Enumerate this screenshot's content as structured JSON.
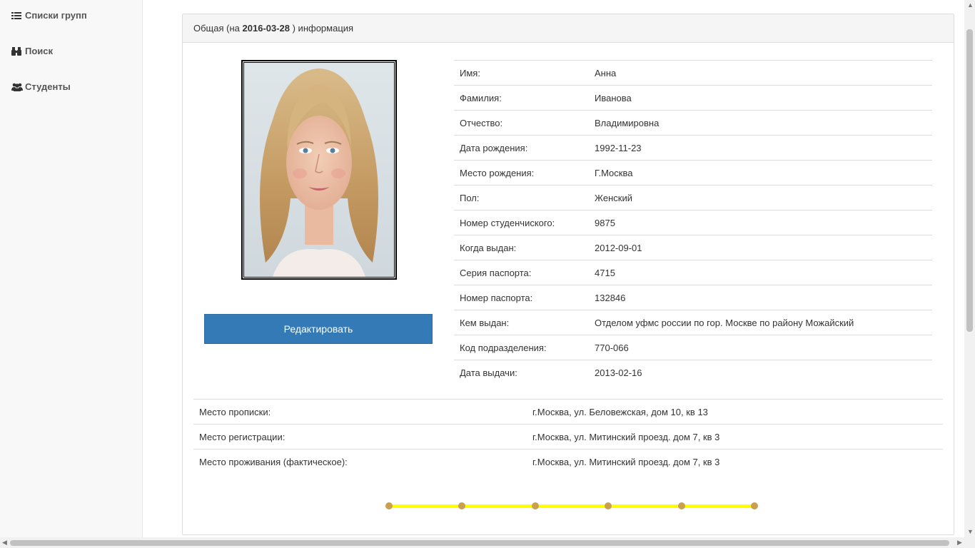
{
  "sidebar": {
    "items": [
      {
        "label": "Списки групп",
        "icon": "list-icon"
      },
      {
        "label": "Поиск",
        "icon": "binoculars-icon"
      },
      {
        "label": "Студенты",
        "icon": "users-icon"
      }
    ]
  },
  "panel": {
    "heading_prefix": "Общая (на ",
    "heading_date": "2016-03-28",
    "heading_suffix": " ) информация"
  },
  "edit_button_label": "Редактировать",
  "info": [
    {
      "label": "Имя:",
      "value": "Анна"
    },
    {
      "label": "Фамилия:",
      "value": "Иванова"
    },
    {
      "label": "Отчество:",
      "value": "Владимировна"
    },
    {
      "label": "Дата рождения:",
      "value": "1992-11-23"
    },
    {
      "label": "Место рождения:",
      "value": "Г.Москва"
    },
    {
      "label": "Пол:",
      "value": "Женский"
    },
    {
      "label": "Номер студенчиского:",
      "value": "9875"
    },
    {
      "label": "Когда выдан:",
      "value": "2012-09-01"
    },
    {
      "label": "Серия паспорта:",
      "value": "4715"
    },
    {
      "label": "Номер паспорта:",
      "value": "132846"
    },
    {
      "label": "Кем выдан:",
      "value": "Отделом уфмс россии по гор. Москве по району Можайский"
    },
    {
      "label": "Код подразделения:",
      "value": "770-066"
    },
    {
      "label": "Дата выдачи:",
      "value": "2013-02-16"
    }
  ],
  "address": [
    {
      "label": "Место прописки:",
      "value": "г.Москва, ул. Беловежская, дом 10, кв 13"
    },
    {
      "label": "Место регистрации:",
      "value": "г.Москва, ул. Митинский проезд. дом 7, кв 3"
    },
    {
      "label": "Место проживания (фактическое):",
      "value": "г.Москва, ул. Митинский проезд. дом 7, кв 3"
    }
  ],
  "colors": {
    "primary": "#337ab7",
    "progress_track": "#ffff00",
    "progress_dot": "#c8a050"
  }
}
